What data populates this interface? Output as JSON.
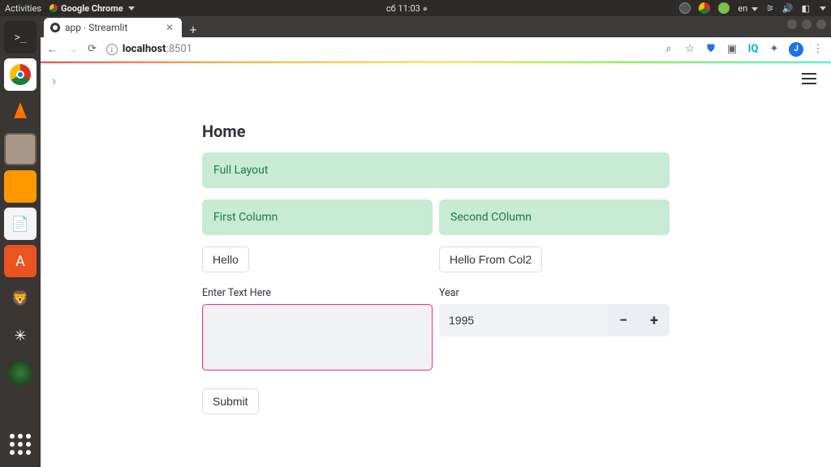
{
  "ubuntu_topbar": {
    "activities": "Activities",
    "app_name": "Google Chrome",
    "clock": "сб 11:03",
    "lang": "en"
  },
  "browser": {
    "tab_title": "app · Streamlit",
    "url_host": "localhost",
    "url_port": ":8501",
    "avatar_initial": "J"
  },
  "page": {
    "title": "Home",
    "full_layout": "Full Layout",
    "col1_header": "First Column",
    "col2_header": "Second COlumn",
    "btn_hello": "Hello",
    "btn_hello2": "Hello From Col2",
    "text_label": "Enter Text Here",
    "text_value": "",
    "year_label": "Year",
    "year_value": "1995",
    "submit": "Submit"
  }
}
